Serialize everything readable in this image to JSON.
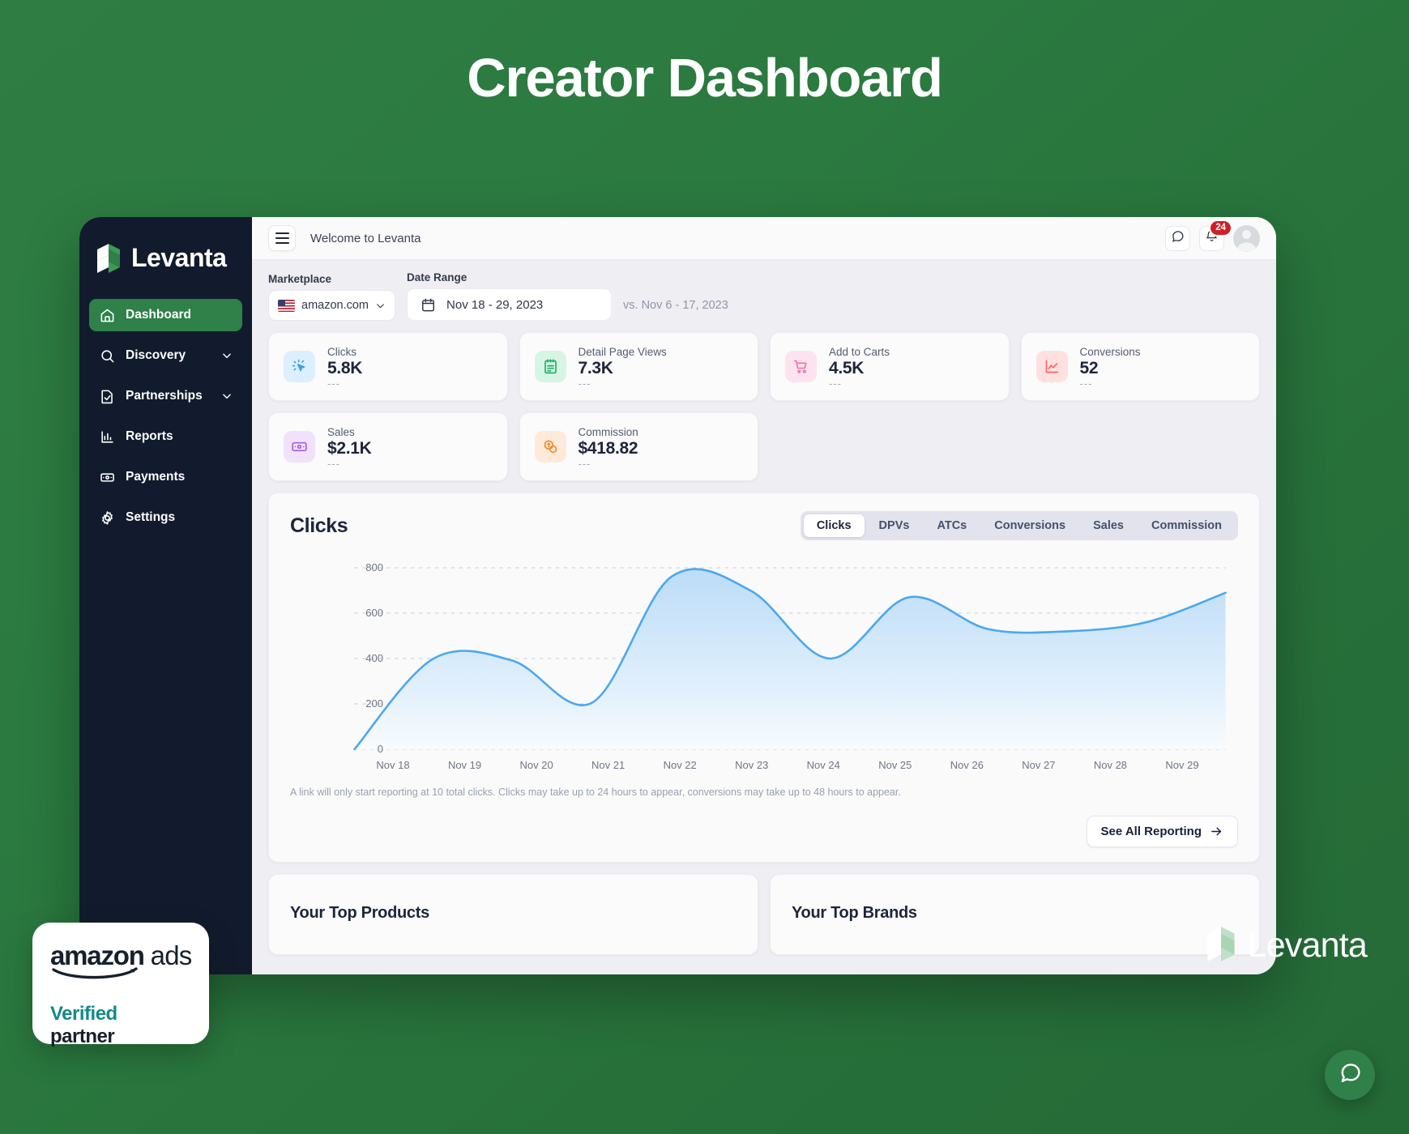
{
  "hero": {
    "title": "Creator Dashboard"
  },
  "brand": {
    "name": "Levanta"
  },
  "sidebar": {
    "items": [
      {
        "label": "Dashboard",
        "icon": "home-icon",
        "active": true,
        "chevron": false
      },
      {
        "label": "Discovery",
        "icon": "search-icon",
        "active": false,
        "chevron": true
      },
      {
        "label": "Partnerships",
        "icon": "document-check-icon",
        "active": false,
        "chevron": true
      },
      {
        "label": "Reports",
        "icon": "bar-chart-icon",
        "active": false,
        "chevron": false
      },
      {
        "label": "Payments",
        "icon": "banknote-icon",
        "active": false,
        "chevron": false
      },
      {
        "label": "Settings",
        "icon": "gear-icon",
        "active": false,
        "chevron": false
      }
    ]
  },
  "topbar": {
    "welcome": "Welcome to Levanta",
    "notification_count": "24"
  },
  "filters": {
    "marketplace_label": "Marketplace",
    "marketplace_value": "amazon.com",
    "date_label": "Date Range",
    "date_value": "Nov 18 - 29, 2023",
    "comparison": "vs. Nov 6 - 17, 2023"
  },
  "kpis": [
    {
      "label": "Clicks",
      "value": "5.8K",
      "delta": "---",
      "icon": "cursor-click-icon",
      "bg": "#dcefff",
      "fg": "#3fa0ef"
    },
    {
      "label": "Detail Page Views",
      "value": "7.3K",
      "delta": "---",
      "icon": "clipboard-icon",
      "bg": "#d7f5e4",
      "fg": "#23b16a"
    },
    {
      "label": "Add to Carts",
      "value": "4.5K",
      "delta": "---",
      "icon": "shopping-cart-icon",
      "bg": "#fde3ef",
      "fg": "#f472ad"
    },
    {
      "label": "Conversions",
      "value": "52",
      "delta": "---",
      "icon": "line-chart-icon",
      "bg": "#ffe0e0",
      "fg": "#fa6666"
    },
    {
      "label": "Sales",
      "value": "$2.1K",
      "delta": "---",
      "icon": "banknote-icon",
      "bg": "#f0e2fb",
      "fg": "#a45ee0"
    },
    {
      "label": "Commission",
      "value": "$418.82",
      "delta": "---",
      "icon": "coins-icon",
      "bg": "#ffeada",
      "fg": "#f08a2e"
    }
  ],
  "chart_panel": {
    "title": "Clicks",
    "tabs": [
      {
        "label": "Clicks",
        "active": true
      },
      {
        "label": "DPVs",
        "active": false
      },
      {
        "label": "ATCs",
        "active": false
      },
      {
        "label": "Conversions",
        "active": false
      },
      {
        "label": "Sales",
        "active": false
      },
      {
        "label": "Commission",
        "active": false
      }
    ],
    "note": "A link will only start reporting at 10 total clicks. Clicks may take up to 24 hours to appear, conversions may take up to 48 hours to appear.",
    "see_all_label": "See All Reporting"
  },
  "chart_data": {
    "type": "area",
    "title": "Clicks",
    "xlabel": "",
    "ylabel": "",
    "grid": true,
    "legend": "none",
    "line_color": "#4aa8f0",
    "fill_color": "#c9e3fa",
    "ylim": [
      0,
      850
    ],
    "yticks": [
      0,
      200,
      400,
      600,
      800
    ],
    "categories": [
      "Nov 18",
      "Nov 19",
      "Nov 20",
      "Nov 21",
      "Nov 22",
      "Nov 23",
      "Nov 24",
      "Nov 25",
      "Nov 26",
      "Nov 27",
      "Nov 28",
      "Nov 29"
    ],
    "series": [
      {
        "name": "Clicks",
        "values": [
          0,
          400,
          390,
          205,
          760,
          700,
          400,
          670,
          530,
          520,
          560,
          690
        ]
      }
    ]
  },
  "bottom_cards": [
    {
      "title": "Your Top Products"
    },
    {
      "title": "Your Top Brands"
    }
  ],
  "ads_badge": {
    "amazon": "amazon",
    "ads": "ads",
    "verified": "Verified",
    "partner": "partner"
  },
  "footer": {
    "logo_text": "Levanta"
  },
  "colors": {
    "page_green": "#2b7a40",
    "sidebar": "#121b2d",
    "accent_green": "#2f8049",
    "chart_blue": "#4aa8f0",
    "badge_red": "#cd2026",
    "teal": "#128a8a"
  }
}
